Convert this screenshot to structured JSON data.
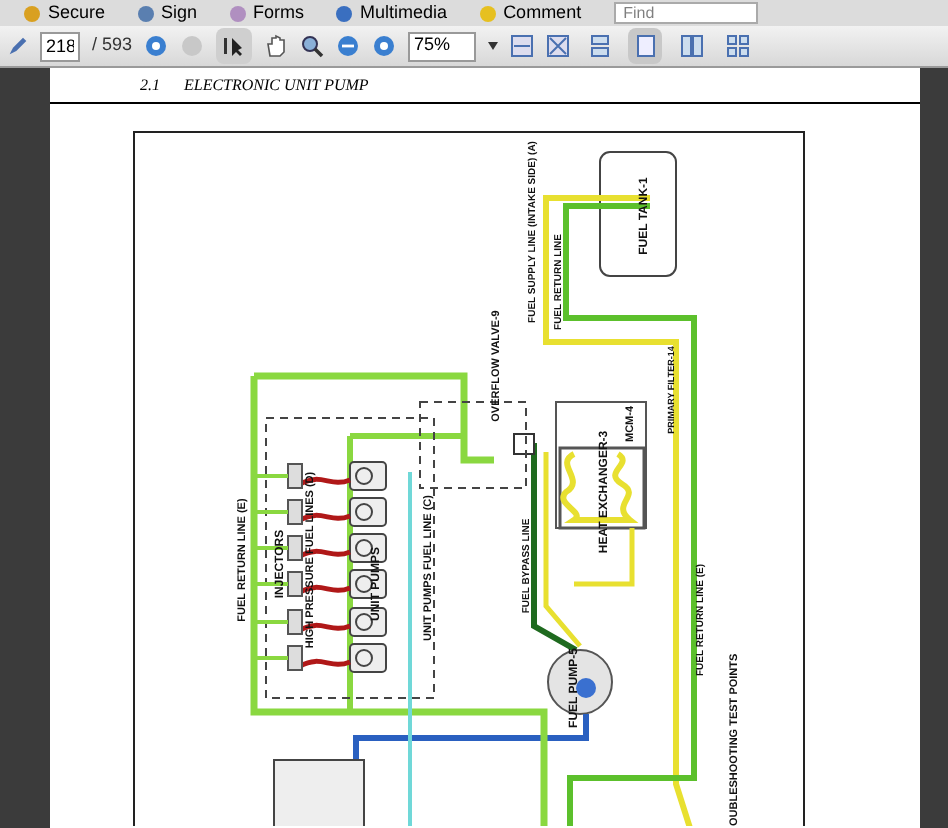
{
  "menu_bar": {
    "items": [
      "Secure",
      "Sign",
      "Forms",
      "Multimedia",
      "Comment"
    ],
    "find": {
      "placeholder": "Find"
    }
  },
  "toolbar": {
    "page": "218",
    "page_count": "/ 593",
    "zoom": "75%",
    "layouts": [
      {
        "selected": false
      },
      {
        "selected": true
      },
      {
        "selected": false
      },
      {
        "selected": false
      }
    ]
  },
  "page": {
    "section": "2.1",
    "heading": "ELECTRONIC UNIT PUMP"
  },
  "diagram": {
    "labels": [
      {
        "text": "FUEL TANK-1"
      },
      {
        "text": "FUEL SUPPLY LINE (INTAKE SIDE) (A)"
      },
      {
        "text": "FUEL RETURN LINE"
      },
      {
        "text": "PRIMARY FILTER-14"
      },
      {
        "text": "OVERFLOW VALVE-9"
      },
      {
        "text": "MCM-4"
      },
      {
        "text": "HEAT EXCHANGER-3"
      },
      {
        "text": "FUEL BYPASS LINE"
      },
      {
        "text": "FUEL RETURN LINE (E)"
      },
      {
        "text": "INJECTORS"
      },
      {
        "text": "HIGH PRESSURE FUEL LINES (D)"
      },
      {
        "text": "UNIT PUMPS"
      },
      {
        "text": "UNIT PUMPS FUEL LINE (C)"
      },
      {
        "text": "FUEL RETURN LINE (E)"
      },
      {
        "text": "FUEL PUMP-5"
      },
      {
        "text": "OUBLESHOOTING TEST POINTS"
      }
    ]
  }
}
